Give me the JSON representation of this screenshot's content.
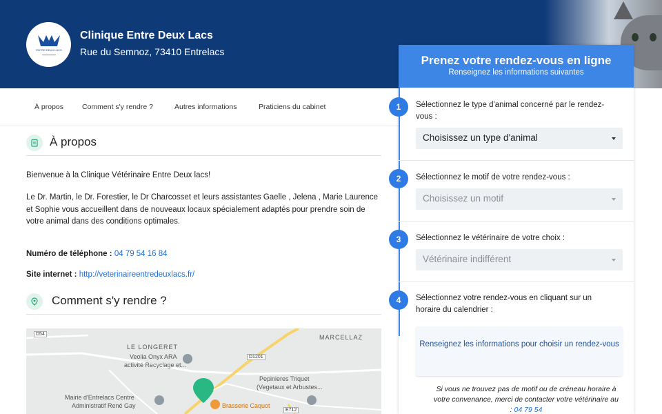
{
  "header": {
    "clinic_name": "Clinique Entre Deux Lacs",
    "address": "Rue du Semnoz, 73410 Entrelacs",
    "logo_text": "ENTRE DEUX LACS",
    "colors": {
      "header_bg": "#0f3a78",
      "accent": "#3d86e6"
    }
  },
  "nav": {
    "items": [
      "À propos",
      "Comment s'y rendre ?",
      "Autres informations",
      "Praticiens du cabinet"
    ]
  },
  "about": {
    "title": "À propos",
    "icon": "clipboard-icon",
    "welcome": "Bienvenue à la Clinique Vétérinaire Entre Deux lacs!",
    "description": "Le Dr. Martin, le Dr. Forestier, le Dr  Charcosset et leurs assistantes Gaelle , Jelena , Marie Laurence et Sophie vous accueillent dans de nouveaux locaux spécialement adaptés pour prendre soin de votre animal dans des conditions optimales.",
    "phone_label": "Numéro de téléphone :",
    "phone": "04 79 54 16 84",
    "website_label": "Site internet :",
    "website": "http://veterinaireentredeuxlacs.fr/"
  },
  "directions": {
    "title": "Comment s'y rendre ?",
    "icon": "location-pin-icon",
    "map_labels": {
      "longeret": "LE LONGERET",
      "marcellaz": "MARCELLAZ",
      "veolia": "Veolia Onyx ARA",
      "veolia2": "activité Recyclage et...",
      "pepinieres": "Pepinieres Triquet",
      "pepinieres2": "(Vegetaux et Arbustes...",
      "mairie": "Mairie d'Entrelacs Centre",
      "mairie2": "Administratif René Gay",
      "brasserie": "Brasserie Caquot",
      "road_d54": "D54",
      "road_d1201": "D1201",
      "road_e712": "E712"
    }
  },
  "booking": {
    "title": "Prenez votre rendez-vous en ligne",
    "subtitle": "Renseignez les informations suivantes",
    "steps": [
      {
        "number": "1",
        "label": "Sélectionnez le type d'animal concerné par le rendez-vous :",
        "value": "Choisissez un type d'animal"
      },
      {
        "number": "2",
        "label": "Sélectionnez le motif de votre rendez-vous :",
        "value": "Choisissez un motif"
      },
      {
        "number": "3",
        "label": "Sélectionnez le vétérinaire de votre choix :",
        "value": "Vétérinaire indifférent"
      },
      {
        "number": "4",
        "label": "Sélectionnez votre rendez-vous en cliquant sur un horaire du calendrier :"
      }
    ],
    "info_box": "Renseignez les informations pour choisir un rendez-vous",
    "note": "Si vous ne trouvez pas de motif ou de créneau horaire à votre convenance, merci de contacter votre vétérinaire au :",
    "note_phone": "04 79 54"
  }
}
